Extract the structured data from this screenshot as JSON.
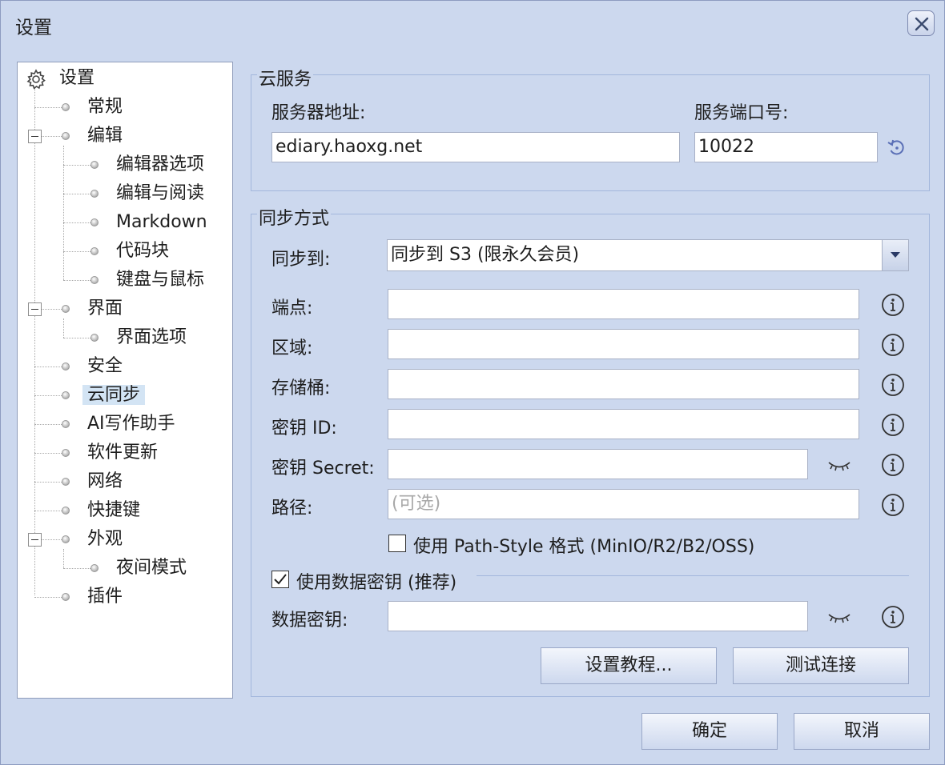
{
  "window": {
    "title": "设置"
  },
  "tree": {
    "root": "设置",
    "items": [
      "常规",
      "编辑",
      "编辑器选项",
      "编辑与阅读",
      "Markdown",
      "代码块",
      "键盘与鼠标",
      "界面",
      "界面选项",
      "安全",
      "云同步",
      "AI写作助手",
      "软件更新",
      "网络",
      "快捷键",
      "外观",
      "夜间模式",
      "插件"
    ],
    "selected": "云同步"
  },
  "cloud": {
    "title": "云服务",
    "server_label": "服务器地址:",
    "server_value": "ediary.haoxg.net",
    "port_label": "服务端口号:",
    "port_value": "10022"
  },
  "sync": {
    "title": "同步方式",
    "sync_to_label": "同步到:",
    "sync_to_value": "同步到 S3 (限永久会员)",
    "endpoint_label": "端点:",
    "region_label": "区域:",
    "bucket_label": "存储桶:",
    "key_id_label": "密钥 ID:",
    "key_secret_label": "密钥 Secret:",
    "path_label": "路径:",
    "path_placeholder": "(可选)",
    "path_style_label": "使用 Path-Style 格式 (MinIO/R2/B2/OSS)",
    "path_style_checked": false,
    "use_data_key_label": "使用数据密钥 (推荐)",
    "use_data_key_checked": true,
    "data_key_label": "数据密钥:",
    "tutorial_button": "设置教程...",
    "test_button": "测试连接"
  },
  "footer": {
    "ok": "确定",
    "cancel": "取消"
  },
  "icons": [
    "gear-icon",
    "close-icon",
    "refresh-icon",
    "info-icon",
    "eye-closed-icon",
    "checkmark-icon",
    "dropdown-arrow-icon"
  ]
}
